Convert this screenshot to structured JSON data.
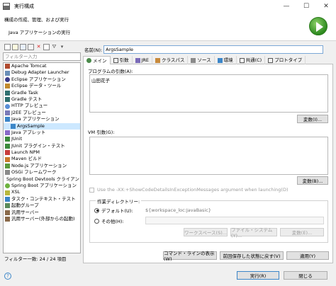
{
  "window": {
    "title": "実行構成",
    "minimize": "—",
    "maximize": "☐",
    "close": "✕"
  },
  "banner": {
    "description": "構成の作成、管理、および実行",
    "subtitle": "Java アプリケーションの実行"
  },
  "left": {
    "filter_placeholder": "フィルター入力",
    "items": [
      {
        "label": "Apache Tomcat"
      },
      {
        "label": "Debug Adapter Launcher"
      },
      {
        "label": "Eclipse アプリケーション"
      },
      {
        "label": "Eclipse データ・ツール"
      },
      {
        "label": "Gradle Task"
      },
      {
        "label": "Gradle テスト"
      },
      {
        "label": "HTTP プレビュー"
      },
      {
        "label": "J2EE プレビュー"
      },
      {
        "label": "Java アプリケーション"
      },
      {
        "label": "ArgsSample"
      },
      {
        "label": "Java アプレット"
      },
      {
        "label": "JUnit"
      },
      {
        "label": "JUnit プラグイン・テスト"
      },
      {
        "label": "Launch NPM"
      },
      {
        "label": "Maven ビルド"
      },
      {
        "label": "Node.js アプリケーション"
      },
      {
        "label": "OSGi フレームワーク"
      },
      {
        "label": "Spring Boot Devtools クライアント"
      },
      {
        "label": "Spring Boot アプリケーション"
      },
      {
        "label": "XSL"
      },
      {
        "label": "タスク・コンテキスト・テスト"
      },
      {
        "label": "起動グループ"
      },
      {
        "label": "汎用サーバー"
      },
      {
        "label": "汎用サーバー(外部からの起動)"
      }
    ],
    "status": "フィルター一致: 24 / 24 項目"
  },
  "config": {
    "name_label": "名前(N):",
    "name_value": "ArgsSample",
    "tabs": [
      {
        "label": "メイン"
      },
      {
        "label": "引数"
      },
      {
        "label": "JRE"
      },
      {
        "label": "クラスパス"
      },
      {
        "label": "ソース"
      },
      {
        "label": "環境"
      },
      {
        "label": "共通(C)"
      },
      {
        "label": "プロトタイプ"
      }
    ],
    "program_args_label": "プログラムの引数(A):",
    "program_args_value": "山田花子",
    "variables_button": "変数(I)...",
    "vm_args_label": "VM 引数(G):",
    "vm_args_value": "",
    "variables_button_2": "変数(B)...",
    "xx_option_label": "Use the -XX:+ShowCodeDetailsInExceptionMessages argument when launching(D)",
    "working_dir_label": "作業ディレクトリー:",
    "default_label": "デフォルト(U):",
    "default_value": "${workspace_loc:JavaBasic}",
    "other_label": "その他(H):",
    "workspace_button": "ワークスペース(S)...",
    "filesystem_button": "ファイル・システム(Y)...",
    "variables_button_3": "変数(E)...",
    "show_command_button": "コマンド・ラインの表示(W)",
    "revert_button": "前回保存した状態に戻す(V)",
    "apply_button": "適用(Y)"
  },
  "footer": {
    "run_button": "実行(R)",
    "close_button": "閉じる"
  }
}
